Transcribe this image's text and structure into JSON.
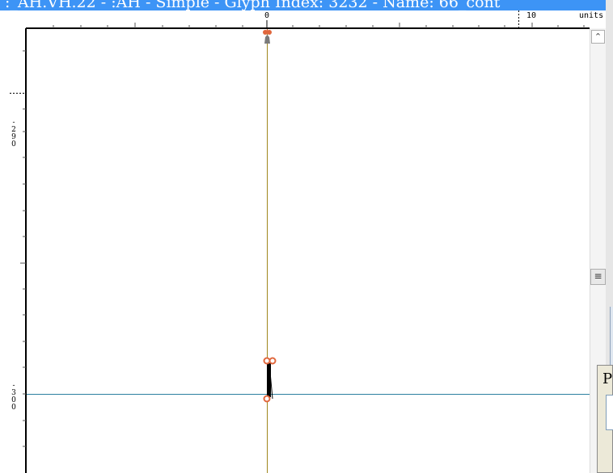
{
  "window": {
    "title": ":_AH.VH.22 - :AH - Simple - Glyph Index: 3232 - Name: 66_cont"
  },
  "ruler": {
    "h_zero_label": "0",
    "h_ten_label": "10",
    "units_label": "units",
    "v_label_290": "-290",
    "v_label_300": "-300"
  },
  "canvas": {
    "colors": {
      "baseline_vertical": "#a0861d",
      "baseline_horizontal": "#2b7fa0",
      "point": "#e0673d",
      "contour": "#000000",
      "phantom": "#7a7a7a"
    }
  },
  "scrollbar": {
    "up_icon": "chevron-up-icon",
    "thumb_icon": "grip-icon"
  },
  "background_window": {
    "label": "P"
  }
}
